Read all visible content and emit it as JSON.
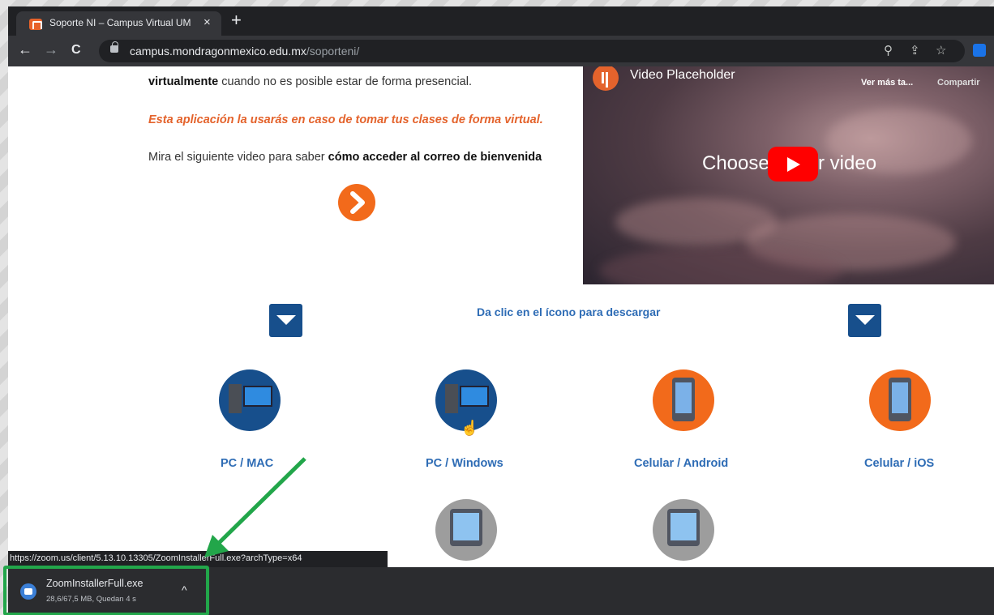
{
  "browser": {
    "tab_title": "Soporte NI – Campus Virtual UM",
    "tab_close": "×",
    "new_tab": "+",
    "back": "←",
    "forward": "→",
    "reload": "C",
    "url_host": "campus.mondragonmexico.edu.mx",
    "url_path": "/soporteni/"
  },
  "page": {
    "line1_bold": "virtualmente",
    "line1_rest": " cuando no es posible estar de forma presencial.",
    "orange_line": "Esta aplicación la usarás en caso de tomar tus clases de forma virtual.",
    "line3_start": "Mira el siguiente video para saber ",
    "line3_bold": "cómo acceder al correo de bienvenida",
    "video": {
      "title": "Video Placeholder",
      "watch_later": "Ver más ta...",
      "share": "Compartir",
      "center_left": "Choose",
      "center_right": "r video"
    },
    "download_title": "Da clic en el ícono para descargar",
    "devices": [
      {
        "label": "PC / MAC"
      },
      {
        "label": "PC / Windows"
      },
      {
        "label": "Celular / Android"
      },
      {
        "label": "Celular / iOS"
      }
    ],
    "status_url": "https://zoom.us/client/5.13.10.13305/ZoomInstallerFull.exe?archType=x64"
  },
  "download_bar": {
    "filename": "ZoomInstallerFull.exe",
    "status": "28,6/67,5 MB, Quedan 4 s",
    "chevron": "^"
  },
  "colors": {
    "accent_orange": "#f26a1b",
    "blue": "#174f8c",
    "link_blue": "#2e6cb5",
    "highlight_green": "#22a64a"
  }
}
